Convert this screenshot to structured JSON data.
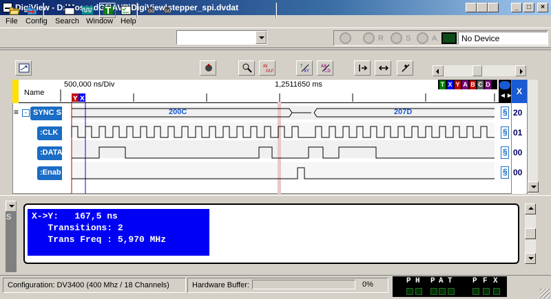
{
  "window": {
    "title": "DigiView - D:\\MossadG5\\AVR\\DigiView\\stepper_spi.dvdat",
    "controls": {
      "minimize": "_",
      "maximize": "□",
      "close": "×"
    }
  },
  "menu": [
    "File",
    "Config",
    "Search",
    "Window",
    "Help"
  ],
  "toolbar": {
    "combo_value": "",
    "run_labels": {
      "r": "R",
      "s": "S",
      "a": "A"
    },
    "device_status": "No Device"
  },
  "waveform": {
    "name_header": "Name",
    "timebase": "500,000 ns/Div",
    "cursor_time": "1,2511650 ms",
    "x_header": "X",
    "markers": [
      "T",
      "X",
      "Y",
      "A",
      "B",
      "C",
      "D"
    ],
    "marker_colors": {
      "T": "#008000",
      "X": "#0000ff",
      "Y": "#c00000",
      "A": "#800080",
      "B": "#c00000",
      "C": "#606060",
      "D": "#800080"
    },
    "signals": [
      {
        "name": "SYNC S",
        "collapse": "-",
        "x_value": "20",
        "bus_values": [
          "200C",
          "207D"
        ]
      },
      {
        "name": ":CLK",
        "x_value": "01"
      },
      {
        "name": ":DATA",
        "x_value": "00"
      },
      {
        "name": ":Enab",
        "x_value": "00"
      }
    ]
  },
  "stats": {
    "line1": "X->Y:   167,5 ns",
    "line2": "   Transitions: 2",
    "line3": "   Trans Freq : 5,970 MHz"
  },
  "side_label": "S",
  "status": {
    "configuration": "Configuration:  DV3400 (400 Mhz / 18 Channels)",
    "buffer_label": "Hardware Buffer:",
    "buffer_percent": "0%",
    "buffer_fill": 0,
    "flags": [
      "P",
      "H",
      "P",
      "A",
      "T",
      "P",
      "F",
      "X"
    ]
  },
  "colors": {
    "accent_blue": "#1a6cc4",
    "stats_bg": "#0000f4",
    "cursor_x": "#0000ff",
    "cursor_y": "#c00000"
  }
}
